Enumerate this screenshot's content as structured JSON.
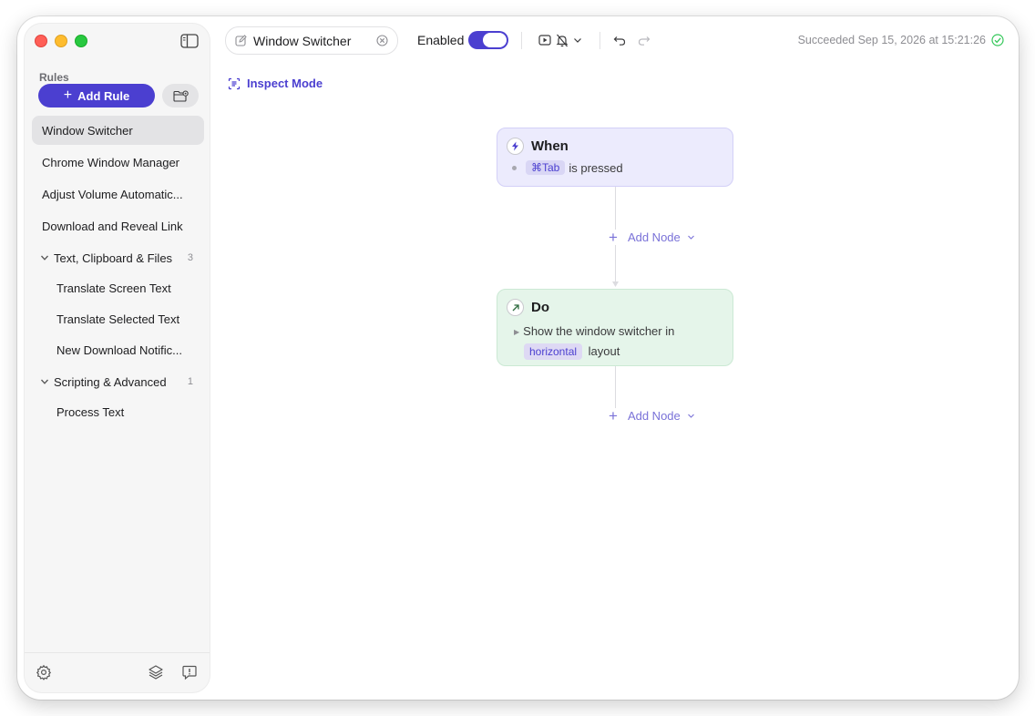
{
  "sidebar": {
    "heading": "Rules",
    "add_rule_label": "Add Rule",
    "rules": [
      {
        "label": "Window Switcher",
        "selected": true
      },
      {
        "label": "Chrome Window Manager"
      },
      {
        "label": "Adjust Volume Automatic..."
      },
      {
        "label": "Download and Reveal Link"
      }
    ],
    "groups": [
      {
        "label": "Text, Clipboard & Files",
        "count": "3",
        "items": [
          "Translate Screen Text",
          "Translate Selected Text",
          "New Download Notific..."
        ]
      },
      {
        "label": "Scripting & Advanced",
        "count": "1",
        "items": [
          "Process Text"
        ]
      }
    ]
  },
  "toolbar": {
    "rule_name": "Window Switcher",
    "enabled_label": "Enabled",
    "enabled": true,
    "status": "Succeeded Sep 15, 2026 at 15:21:26"
  },
  "inspect_label": "Inspect Mode",
  "nodes": {
    "when": {
      "title": "When",
      "shortcut": "⌘Tab",
      "text": "is pressed"
    },
    "do": {
      "title": "Do",
      "text": "Show the window switcher in",
      "chip": "horizontal",
      "suffix": "layout"
    }
  },
  "add_node_label": "Add Node",
  "colors": {
    "accent": "#4b3fd0",
    "when_bg": "#ecebfd",
    "do_bg": "#e5f5ea",
    "success": "#34c759"
  },
  "icons": {
    "sidebar_toggle": "sidebar-icon",
    "new_folder": "folder-badge-icon",
    "settings": "gear-icon",
    "layers": "layers-icon",
    "feedback": "feedback-icon"
  }
}
